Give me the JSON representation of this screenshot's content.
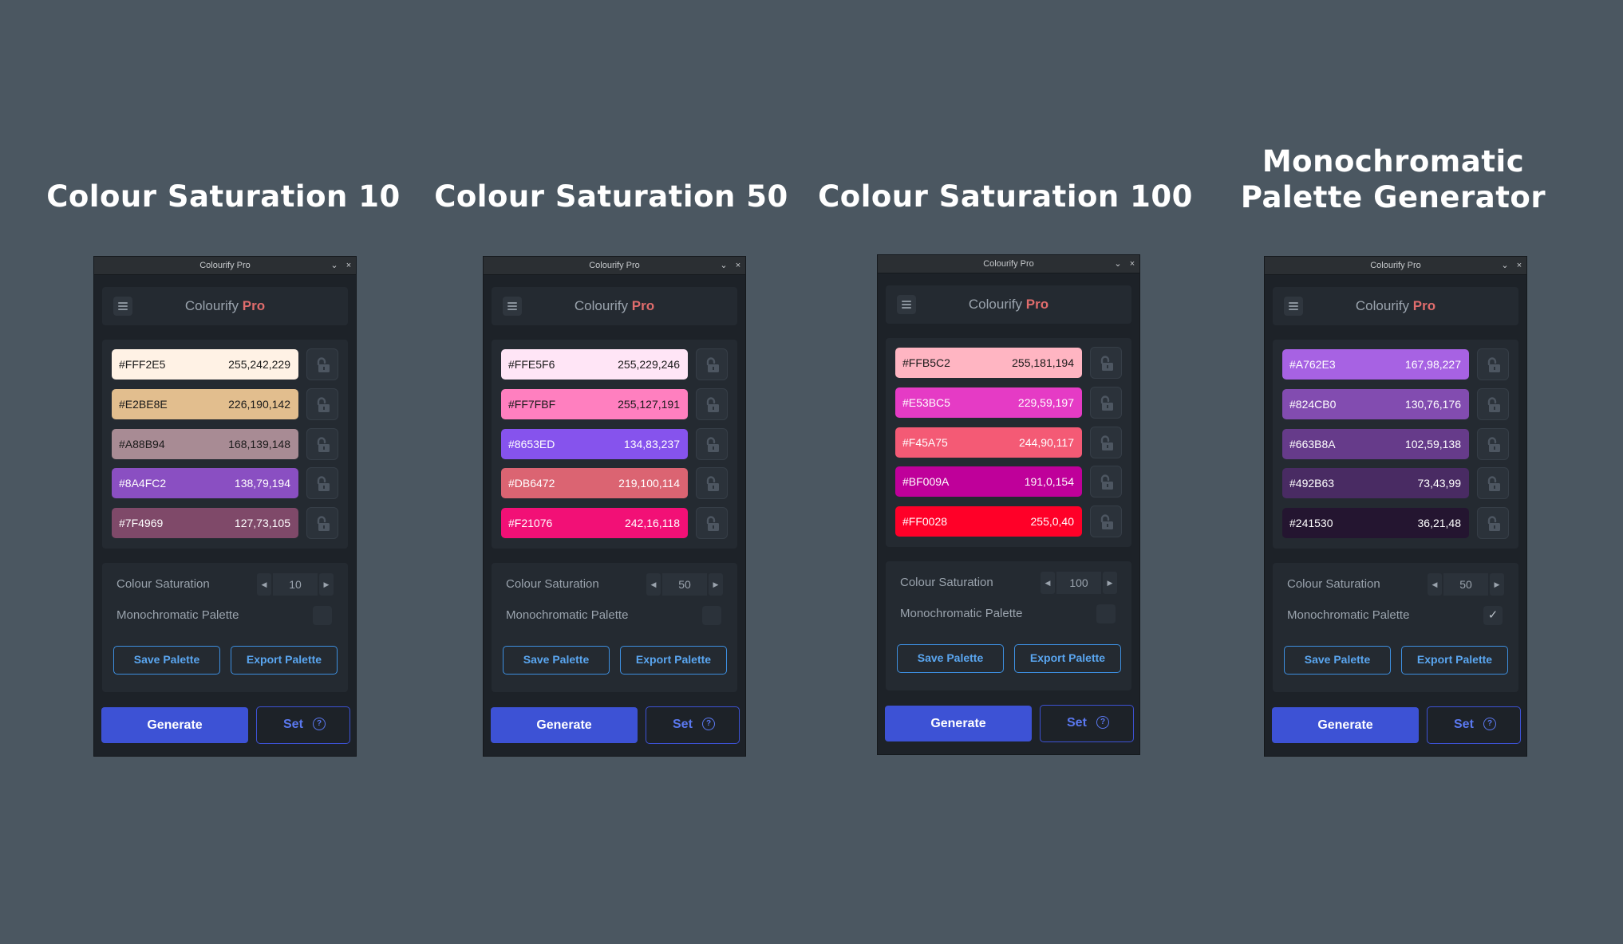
{
  "app": {
    "window_title": "Colourify Pro",
    "name": "Colourify",
    "name_suffix": "Pro",
    "minimize_glyph": "⌄",
    "close_glyph": "×",
    "lock_icon": "unlocked-padlock-icon"
  },
  "labels": {
    "saturation": "Colour Saturation",
    "monochromatic": "Monochromatic Palette",
    "save_palette": "Save Palette",
    "export_palette": "Export Palette",
    "generate": "Generate",
    "set": "Set",
    "help": "?"
  },
  "columns": [
    {
      "title_line1": "Colour Saturation 10",
      "title_line2": "",
      "saturation": "10",
      "monochromatic": false,
      "swatches": [
        {
          "hex": "#FFF2E5",
          "rgb": "255,242,229",
          "color": "#FFF2E5",
          "text": "#1a1a1a"
        },
        {
          "hex": "#E2BE8E",
          "rgb": "226,190,142",
          "color": "#E2BE8E",
          "text": "#1a1a1a"
        },
        {
          "hex": "#A88B94",
          "rgb": "168,139,148",
          "color": "#A88B94",
          "text": "#1a1a1a"
        },
        {
          "hex": "#8A4FC2",
          "rgb": "138,79,194",
          "color": "#8A4FC2",
          "text": "#ffffff"
        },
        {
          "hex": "#7F4969",
          "rgb": "127,73,105",
          "color": "#7F4969",
          "text": "#ffffff"
        }
      ]
    },
    {
      "title_line1": "Colour Saturation 50",
      "title_line2": "",
      "saturation": "50",
      "monochromatic": false,
      "swatches": [
        {
          "hex": "#FFE5F6",
          "rgb": "255,229,246",
          "color": "#FFE5F6",
          "text": "#1a1a1a"
        },
        {
          "hex": "#FF7FBF",
          "rgb": "255,127,191",
          "color": "#FF7FBF",
          "text": "#1a1a1a"
        },
        {
          "hex": "#8653ED",
          "rgb": "134,83,237",
          "color": "#8653ED",
          "text": "#ffffff"
        },
        {
          "hex": "#DB6472",
          "rgb": "219,100,114",
          "color": "#DB6472",
          "text": "#ffffff"
        },
        {
          "hex": "#F21076",
          "rgb": "242,16,118",
          "color": "#F21076",
          "text": "#ffffff"
        }
      ]
    },
    {
      "title_line1": "Colour Saturation 100",
      "title_line2": "",
      "saturation": "100",
      "monochromatic": false,
      "swatches": [
        {
          "hex": "#FFB5C2",
          "rgb": "255,181,194",
          "color": "#FFB5C2",
          "text": "#1a1a1a"
        },
        {
          "hex": "#E53BC5",
          "rgb": "229,59,197",
          "color": "#E53BC5",
          "text": "#ffffff"
        },
        {
          "hex": "#F45A75",
          "rgb": "244,90,117",
          "color": "#F45A75",
          "text": "#ffffff"
        },
        {
          "hex": "#BF009A",
          "rgb": "191,0,154",
          "color": "#BF009A",
          "text": "#ffffff"
        },
        {
          "hex": "#FF0028",
          "rgb": "255,0,40",
          "color": "#FF0028",
          "text": "#ffffff"
        }
      ]
    },
    {
      "title_line1": "Monochromatic",
      "title_line2": "Palette Generator",
      "saturation": "50",
      "monochromatic": true,
      "swatches": [
        {
          "hex": "#A762E3",
          "rgb": "167,98,227",
          "color": "#A762E3",
          "text": "#ffffff"
        },
        {
          "hex": "#824CB0",
          "rgb": "130,76,176",
          "color": "#824CB0",
          "text": "#ffffff"
        },
        {
          "hex": "#663B8A",
          "rgb": "102,59,138",
          "color": "#663B8A",
          "text": "#ffffff"
        },
        {
          "hex": "#492B63",
          "rgb": "73,43,99",
          "color": "#492B63",
          "text": "#ffffff"
        },
        {
          "hex": "#241530",
          "rgb": "36,21,48",
          "color": "#241530",
          "text": "#ffffff"
        }
      ]
    }
  ]
}
